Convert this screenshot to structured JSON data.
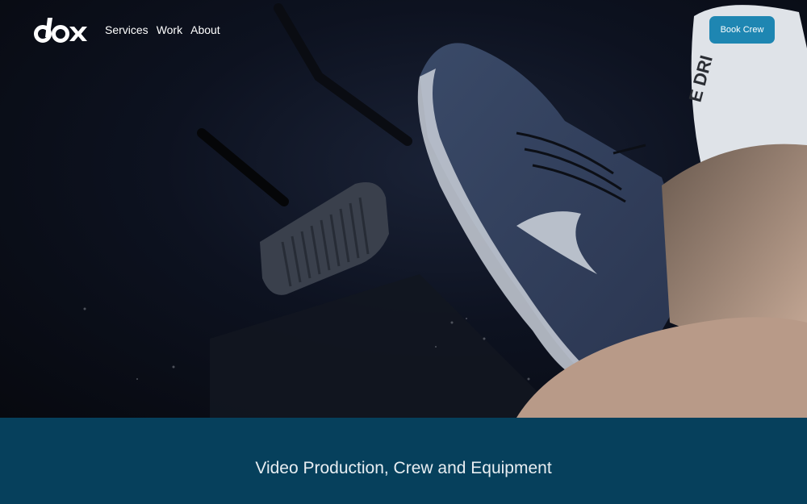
{
  "brand": {
    "logo_text": "dox"
  },
  "nav": {
    "links": [
      {
        "label": "Services"
      },
      {
        "label": "Work"
      },
      {
        "label": "About"
      }
    ],
    "cta_label": "Book Crew"
  },
  "hero": {
    "image": "dark car footwell with sneaker on pedal",
    "sock_text": "E DRI"
  },
  "band": {
    "title": "Video Production, Crew and Equipment"
  },
  "colors": {
    "accent_button": "#1e86b2",
    "band_background": "#06405c"
  }
}
